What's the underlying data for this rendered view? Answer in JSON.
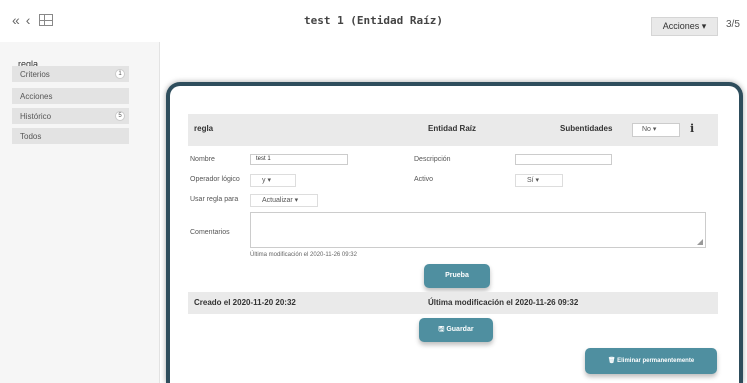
{
  "header": {
    "back_icon": "«",
    "prev_icon": "‹",
    "title": "test 1 (Entidad Raíz)",
    "actions_label": "Acciones ▾",
    "pager": "3/5"
  },
  "sidebar": {
    "heading": "regla",
    "items": [
      {
        "label": "Criterios",
        "badge": "1"
      },
      {
        "label": "Acciones",
        "badge": ""
      },
      {
        "label": "Histórico",
        "badge": "5"
      },
      {
        "label": "Todos",
        "badge": ""
      }
    ]
  },
  "form": {
    "section_title": "regla",
    "entity": "Entidad Raíz",
    "subentities_label": "Subentidades",
    "subentities_value": "No ▾",
    "info_icon": "i",
    "nombre_label": "Nombre",
    "nombre_value": "test 1",
    "descripcion_label": "Descripción",
    "descripcion_value": "",
    "operador_label": "Operador lógico",
    "operador_value": "y ▾",
    "activo_label": "Activo",
    "activo_value": "Sí ▾",
    "usar_label": "Usar regla para",
    "usar_value": "Actualizar ▾",
    "comentarios_label": "Comentarios",
    "last_mod_note": "Última modificación el 2020-11-26 09:32"
  },
  "buttons": {
    "prueba": "Prueba",
    "guardar": "🖫 Guardar",
    "eliminar": "🗑 Eliminar permanentemente"
  },
  "meta": {
    "created": "Creado el 2020-11-20 20:32",
    "modified": "Última modificación el 2020-11-26 09:32"
  },
  "colors": {
    "accent": "#4f8fa0",
    "frame": "#2e4d5c"
  }
}
